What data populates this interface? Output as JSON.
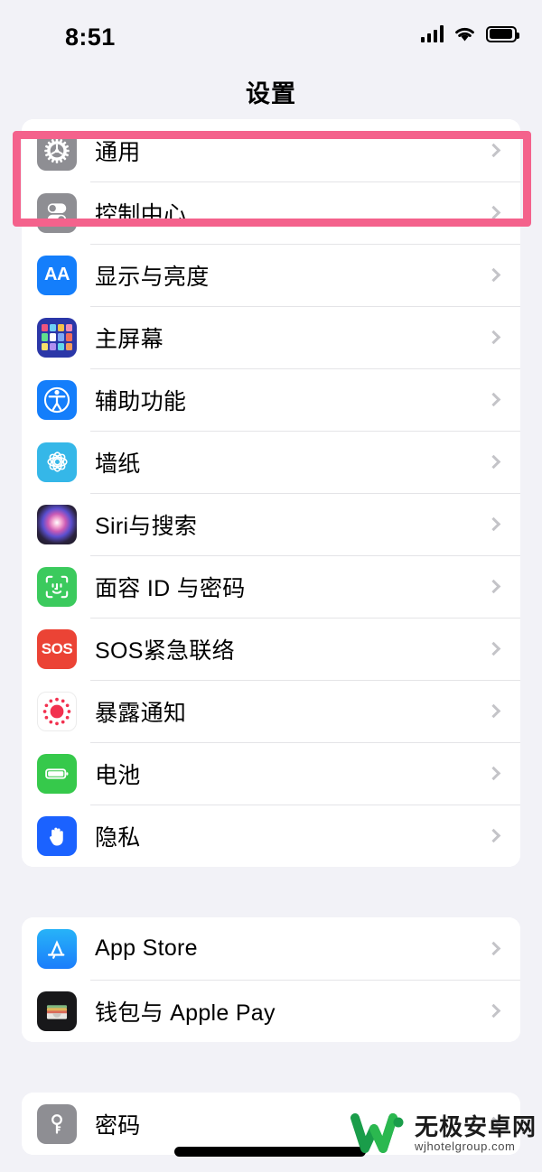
{
  "status_bar": {
    "time": "8:51",
    "icons": [
      "cellular-signal-icon",
      "wifi-icon",
      "battery-icon"
    ]
  },
  "nav": {
    "title": "设置"
  },
  "highlight": {
    "color": "#f4628c",
    "target": "通用"
  },
  "sections": [
    {
      "id": "system",
      "rows": [
        {
          "label": "通用",
          "icon": "gear-icon",
          "icon_color": "#8e8e93"
        },
        {
          "label": "控制中心",
          "icon": "toggles-icon",
          "icon_color": "#8e8e93"
        },
        {
          "label": "显示与亮度",
          "icon": "aa-text-icon",
          "icon_color": "#147efb"
        },
        {
          "label": "主屏幕",
          "icon": "app-grid-icon",
          "icon_color": "#2b37a8"
        },
        {
          "label": "辅助功能",
          "icon": "accessibility-icon",
          "icon_color": "#147efb"
        },
        {
          "label": "墙纸",
          "icon": "flower-icon",
          "icon_color": "#35b7e8"
        },
        {
          "label": "Siri与搜索",
          "icon": "siri-orb-icon",
          "icon_color": "#5b4fd0"
        },
        {
          "label": "面容 ID 与密码",
          "icon": "face-id-icon",
          "icon_color": "#3bca5d"
        },
        {
          "label": "SOS紧急联络",
          "icon": "sos-icon",
          "icon_color": "#eb4335"
        },
        {
          "label": "暴露通知",
          "icon": "exposure-dot-icon",
          "icon_color": "#ef3a5c"
        },
        {
          "label": "电池",
          "icon": "battery-icon",
          "icon_color": "#36c94b"
        },
        {
          "label": "隐私",
          "icon": "hand-icon",
          "icon_color": "#1b62ff"
        }
      ]
    },
    {
      "id": "store",
      "rows": [
        {
          "label": "App Store",
          "icon": "app-store-icon",
          "icon_color": "#1b7dfb"
        },
        {
          "label": "钱包与 Apple Pay",
          "icon": "wallet-icon",
          "icon_color": "#18181a"
        }
      ]
    },
    {
      "id": "accounts",
      "rows": [
        {
          "label": "密码",
          "icon": "key-icon",
          "icon_color": "#8e8e93"
        }
      ]
    }
  ],
  "watermark": {
    "name": "无极安卓网",
    "url": "wjhotelgroup.com",
    "logo_color": "#1a9d4a"
  }
}
